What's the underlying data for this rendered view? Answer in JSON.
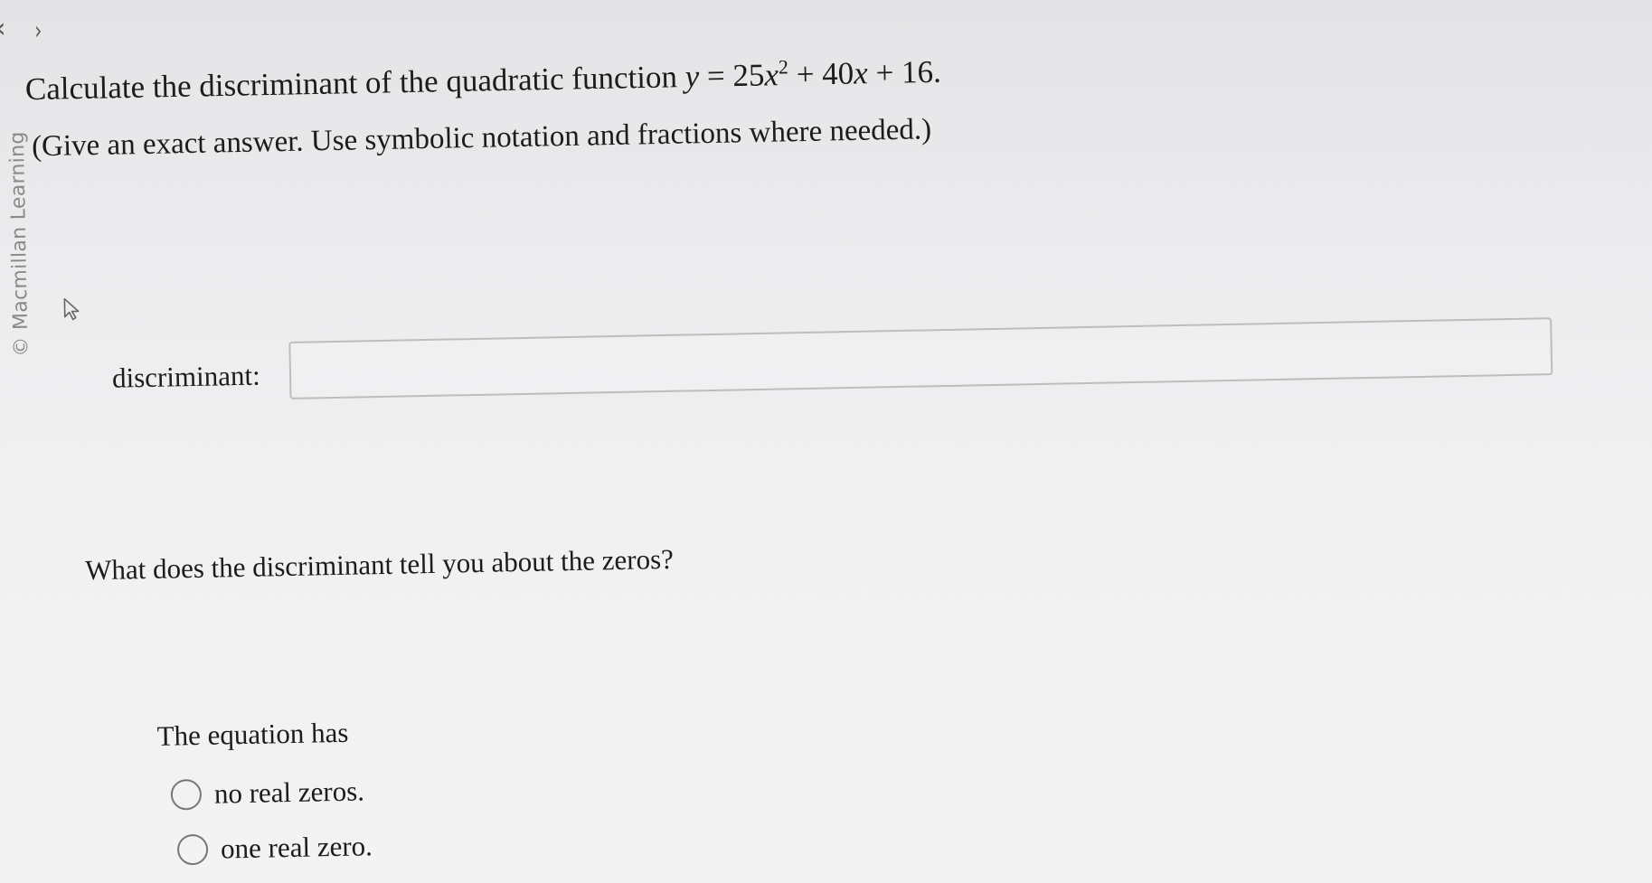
{
  "nav": {
    "prev_glyph": "‹",
    "next_glyph": "›"
  },
  "copyright": "© Macmillan Learning",
  "question": {
    "prefix": "Calculate the discriminant of the quadratic function ",
    "y": "y",
    "equals": " = 25",
    "x1": "x",
    "exp": "2",
    "rest": " + 40",
    "x2": "x",
    "end": " + 16."
  },
  "instructions": "(Give an exact answer. Use symbolic notation and fractions where needed.)",
  "discriminant": {
    "label": "discriminant:",
    "value": ""
  },
  "zeros_question": "What does the discriminant tell you about the zeros?",
  "equation_has": "The equation has",
  "options": [
    {
      "label": "no real zeros."
    },
    {
      "label": "one real zero."
    }
  ],
  "icons": {
    "cursor": "cursor-pointer-icon"
  }
}
